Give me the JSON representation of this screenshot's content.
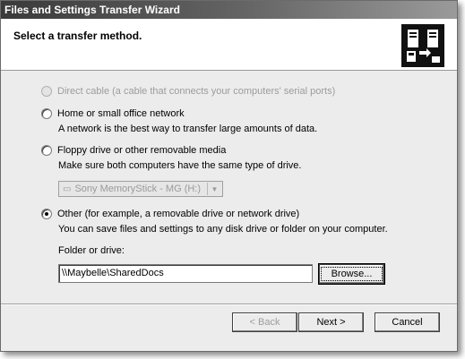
{
  "window": {
    "title": "Files and Settings Transfer Wizard"
  },
  "header": {
    "title": "Select a transfer method."
  },
  "options": {
    "direct": {
      "label": "Direct cable (a cable that connects your computers' serial ports)",
      "state": "disabled"
    },
    "network": {
      "label": "Home or small office network",
      "description": "A network is the best way to transfer large amounts of data.",
      "state": "unchecked"
    },
    "floppy": {
      "label": "Floppy drive or other removable media",
      "description": "Make sure both computers have the same type of drive.",
      "state": "unchecked"
    },
    "other": {
      "label": "Other (for example, a removable drive or network drive)",
      "description": "You can save files and settings to any disk drive or folder on your computer.",
      "state": "checked"
    }
  },
  "drive_select": {
    "selected": "Sony MemoryStick - MG (H:)",
    "icon": "drive-icon"
  },
  "folder": {
    "label": "Folder or drive:",
    "value": "\\\\Maybelle\\SharedDocs"
  },
  "buttons": {
    "browse": "Browse...",
    "back": "< Back",
    "next": "Next >",
    "cancel": "Cancel"
  }
}
